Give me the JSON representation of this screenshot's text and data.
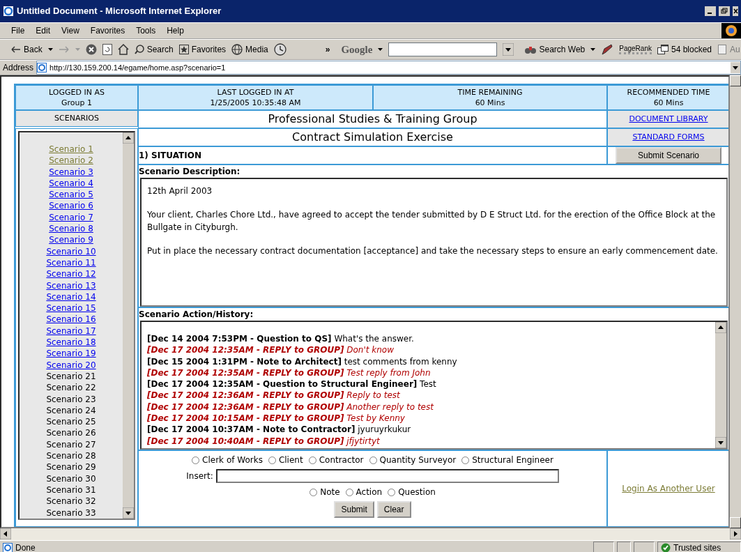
{
  "window": {
    "title": "Untitled Document - Microsoft Internet Explorer"
  },
  "menu": [
    "File",
    "Edit",
    "View",
    "Favorites",
    "Tools",
    "Help"
  ],
  "toolbar": {
    "back": "Back",
    "search": "Search",
    "favorites": "Favorites",
    "media": "Media",
    "chevron": "»",
    "google": "Google",
    "search_web": "Search Web",
    "pagerank": "PageRank",
    "blocked": "54 blocked",
    "cut_button": "Au"
  },
  "address": {
    "label": "Address",
    "url": "http://130.159.200.14/egame/home.asp?scenario=1"
  },
  "header": [
    {
      "label": "LOGGED IN AS",
      "value": "Group 1"
    },
    {
      "label": "LAST LOGGED IN AT",
      "value": "1/25/2005 10:35:48 AM"
    },
    {
      "label": "TIME REMAINING",
      "value": "60 Mins"
    },
    {
      "label": "RECOMMENDED TIME",
      "value": "60 Mins"
    }
  ],
  "scenarios_heading": "SCENARIOS",
  "scenarios": [
    {
      "label": "Scenario 1",
      "kind": "visited"
    },
    {
      "label": "Scenario 2",
      "kind": "visited"
    },
    {
      "label": "Scenario 3",
      "kind": "link"
    },
    {
      "label": "Scenario 4",
      "kind": "link"
    },
    {
      "label": "Scenario 5",
      "kind": "link"
    },
    {
      "label": "Scenario 6",
      "kind": "link"
    },
    {
      "label": "Scenario 7",
      "kind": "link"
    },
    {
      "label": "Scenario 8",
      "kind": "link"
    },
    {
      "label": "Scenario 9",
      "kind": "link"
    },
    {
      "label": "Scenario 10",
      "kind": "link"
    },
    {
      "label": "Scenario 11",
      "kind": "link"
    },
    {
      "label": "Scenario 12",
      "kind": "link"
    },
    {
      "label": "Scenario 13",
      "kind": "link"
    },
    {
      "label": "Scenario 14",
      "kind": "link"
    },
    {
      "label": "Scenario 15",
      "kind": "link"
    },
    {
      "label": "Scenario 16",
      "kind": "link"
    },
    {
      "label": "Scenario 17",
      "kind": "link"
    },
    {
      "label": "Scenario 18",
      "kind": "link"
    },
    {
      "label": "Scenario 19",
      "kind": "link"
    },
    {
      "label": "Scenario 20",
      "kind": "link"
    },
    {
      "label": "Scenario 21",
      "kind": "text"
    },
    {
      "label": "Scenario 22",
      "kind": "text"
    },
    {
      "label": "Scenario 23",
      "kind": "text"
    },
    {
      "label": "Scenario 24",
      "kind": "text"
    },
    {
      "label": "Scenario 25",
      "kind": "text"
    },
    {
      "label": "Scenario 26",
      "kind": "text"
    },
    {
      "label": "Scenario 27",
      "kind": "text"
    },
    {
      "label": "Scenario 28",
      "kind": "text"
    },
    {
      "label": "Scenario 29",
      "kind": "text"
    },
    {
      "label": "Scenario 30",
      "kind": "text"
    },
    {
      "label": "Scenario 31",
      "kind": "text"
    },
    {
      "label": "Scenario 32",
      "kind": "text"
    },
    {
      "label": "Scenario 33",
      "kind": "text"
    }
  ],
  "title": "Professional Studies & Training Group",
  "subtitle": "Contract Simulation Exercise",
  "links": [
    "DOCUMENT LIBRARY",
    "STANDARD FORMS"
  ],
  "situation": "1) SITUATION",
  "submit_scenario": "Submit Scenario",
  "description": {
    "heading": "Scenario Description:",
    "paragraphs": [
      "12th April 2003",
      "Your client, Charles Chore Ltd., have agreed to accept the tender submitted by D E Struct Ltd. for the erection of the Office Block at the Bullgate in Cityburgh.",
      "Put in place the necessary contract documentation [acceptance] and take the necessary steps to ensure an early commencement date."
    ]
  },
  "history": {
    "heading": "Scenario Action/History:",
    "entries": [
      {
        "kind": "message",
        "head": "[Dec 14 2004 7:53PM - Question to QS]",
        "text": "What's the answer."
      },
      {
        "kind": "reply",
        "head": "[Dec 17 2004 12:35AM - REPLY to GROUP]",
        "text": "Don't know"
      },
      {
        "kind": "message",
        "head": "[Dec 15 2004 1:31PM - Note to Architect]",
        "text": "test comments from kenny"
      },
      {
        "kind": "reply",
        "head": "[Dec 17 2004 12:35AM - REPLY to GROUP]",
        "text": "Test reply from John"
      },
      {
        "kind": "message",
        "head": "[Dec 17 2004 12:35AM - Question to Structural Engineer]",
        "text": "Test"
      },
      {
        "kind": "reply",
        "head": "[Dec 17 2004 12:36AM - REPLY to GROUP]",
        "text": "Reply to test"
      },
      {
        "kind": "reply",
        "head": "[Dec 17 2004 12:36AM - REPLY to GROUP]",
        "text": "Another reply to test"
      },
      {
        "kind": "reply",
        "head": "[Dec 17 2004 10:15AM - REPLY to GROUP]",
        "text": "Test by Kenny"
      },
      {
        "kind": "message",
        "head": "[Dec 17 2004 10:37AM - Note to Contractor]",
        "text": "jyuruyrkukur"
      },
      {
        "kind": "reply",
        "head": "[Dec 17 2004 10:40AM - REPLY to GROUP]",
        "text": "jfjytirtyt"
      }
    ]
  },
  "recipients": [
    {
      "label": "Clerk of Works",
      "selected": false
    },
    {
      "label": "Client",
      "selected": false
    },
    {
      "label": "Contractor",
      "selected": false
    },
    {
      "label": "Quantity Surveyor",
      "selected": false
    },
    {
      "label": "Structural Engineer",
      "selected": false
    }
  ],
  "insert_label": "Insert:",
  "entry_types": [
    {
      "label": "Note",
      "selected": false
    },
    {
      "label": "Action",
      "selected": false
    },
    {
      "label": "Question",
      "selected": false
    }
  ],
  "form_buttons": [
    "Submit",
    "Clear"
  ],
  "login_link": "Login As Another User",
  "status_bar": {
    "text": "Done",
    "zone": "Trusted sites"
  }
}
